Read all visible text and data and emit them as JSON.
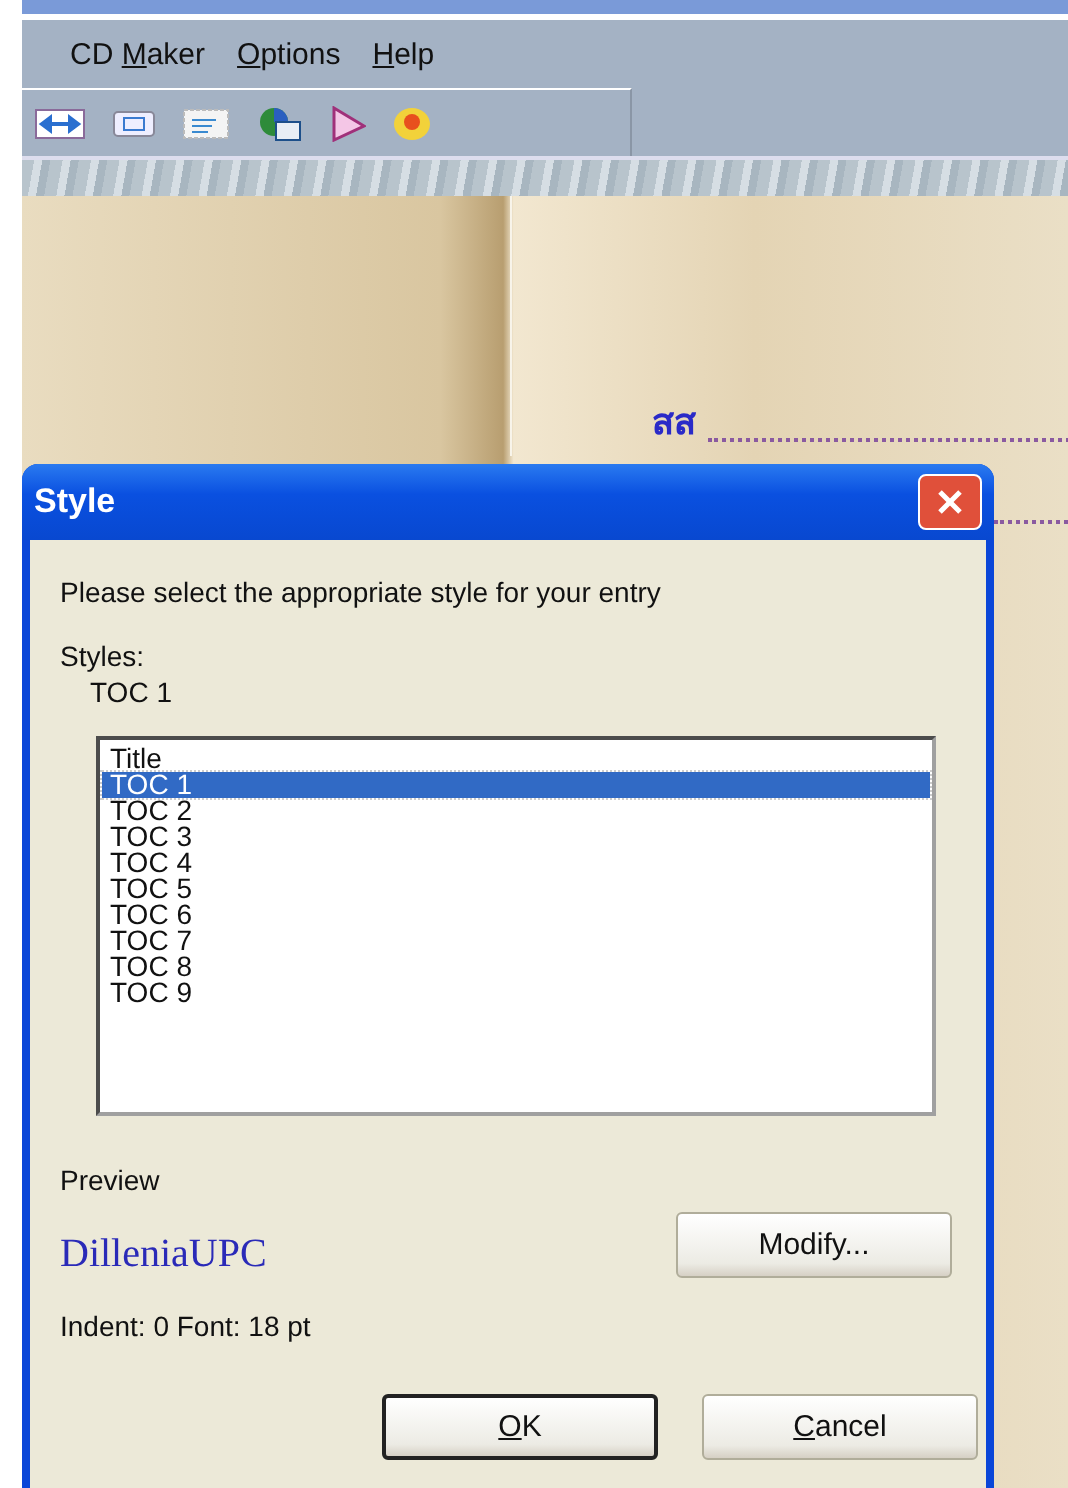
{
  "menu_bar": [
    {
      "pre": "CD ",
      "key": "M",
      "post": "aker"
    },
    {
      "key": "O",
      "post": "ptions"
    },
    {
      "key": "H",
      "post": "elp"
    }
  ],
  "toolbar": [
    {
      "kind": "arrows"
    },
    {
      "kind": "frame"
    },
    {
      "kind": "lines"
    },
    {
      "kind": "globe"
    },
    {
      "kind": "pointer"
    },
    {
      "kind": "disc"
    }
  ],
  "document": {
    "entry": "สส"
  },
  "dialog": {
    "title": "Style",
    "prompt": "Please select the appropriate style for your entry",
    "styles_label": "Styles:",
    "current_style": "TOC 1",
    "styles": [
      {
        "label": "Title",
        "selected": false
      },
      {
        "label": "TOC 1",
        "selected": true
      },
      {
        "label": "TOC 2",
        "selected": false
      },
      {
        "label": "TOC 3",
        "selected": false
      },
      {
        "label": "TOC 4",
        "selected": false
      },
      {
        "label": "TOC 5",
        "selected": false
      },
      {
        "label": "TOC 6",
        "selected": false
      },
      {
        "label": "TOC 7",
        "selected": false
      },
      {
        "label": "TOC 8",
        "selected": false
      },
      {
        "label": "TOC 9",
        "selected": false
      }
    ],
    "preview_label": "Preview",
    "preview_text": "DilleniaUPC",
    "modify_button": "Modify...",
    "details": "Indent: 0 Font: 18 pt",
    "buttons": [
      {
        "key": "O",
        "post": "K",
        "default": true
      },
      {
        "key": "C",
        "post": "ancel",
        "default": false
      }
    ]
  }
}
